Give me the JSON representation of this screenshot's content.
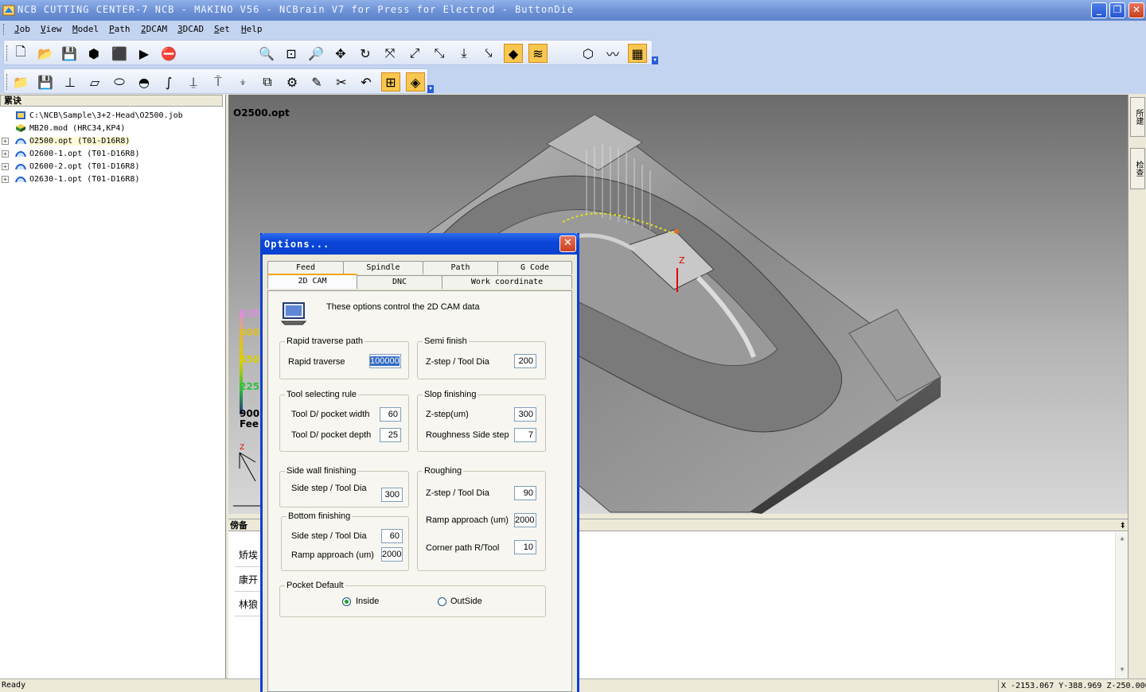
{
  "window": {
    "title": "NCB CUTTING CENTER-7 NCB - MAKINO V56 - NCBrain V7 for Press for Electrod - ButtonDie",
    "min_icon": "minimize-icon",
    "max_icon": "maximize-icon",
    "close_icon": "close-icon",
    "min_glyph": "_",
    "max_glyph": "❐",
    "close_glyph": "✕"
  },
  "menu": [
    "Job",
    "View",
    "Model",
    "Path",
    "2DCAM",
    "3DCAD",
    "Set",
    "Help"
  ],
  "toolbar_row1": [
    {
      "icon": "new-file-icon",
      "glyph": "🗋"
    },
    {
      "icon": "open-add-icon",
      "glyph": "📂"
    },
    {
      "icon": "save-icon",
      "glyph": "💾"
    },
    {
      "icon": "tools-library-icon",
      "glyph": "⬢"
    },
    {
      "icon": "box-model-icon",
      "glyph": "⬛"
    },
    {
      "icon": "run-icon",
      "glyph": "▶"
    },
    {
      "icon": "stop-icon",
      "glyph": "⛔"
    },
    {
      "icon": "zoom-fit-icon",
      "glyph": "🔍"
    },
    {
      "icon": "zoom-window-icon",
      "glyph": "⊡"
    },
    {
      "icon": "zoom-out-icon",
      "glyph": "🔎"
    },
    {
      "icon": "pan-icon",
      "glyph": "✥"
    },
    {
      "icon": "rotate-icon",
      "glyph": "↻"
    },
    {
      "icon": "view-iso-icon",
      "glyph": "⤧"
    },
    {
      "icon": "view-front-icon",
      "glyph": "⤢"
    },
    {
      "icon": "view-side-icon",
      "glyph": "⤡"
    },
    {
      "icon": "view-top-icon",
      "glyph": "⤓"
    },
    {
      "icon": "view-axis-icon",
      "glyph": "⤥"
    },
    {
      "icon": "shaded-view-icon",
      "glyph": "◆"
    },
    {
      "icon": "path-view-icon",
      "glyph": "≋"
    },
    {
      "icon": "stock-icon",
      "glyph": "⬡"
    },
    {
      "icon": "surface-icon",
      "glyph": "〰"
    },
    {
      "icon": "2d-grid-icon",
      "glyph": "▦"
    }
  ],
  "toolbar_row2": [
    {
      "icon": "open-folder-icon",
      "glyph": "📁"
    },
    {
      "icon": "save-disk-icon",
      "glyph": "💾"
    },
    {
      "icon": "origin-icon",
      "glyph": "⊥"
    },
    {
      "icon": "plane-icon",
      "glyph": "▱"
    },
    {
      "icon": "cylinder-icon",
      "glyph": "⬭"
    },
    {
      "icon": "half-shape-icon",
      "glyph": "◓"
    },
    {
      "icon": "curve-icon",
      "glyph": "∫"
    },
    {
      "icon": "ball-tool-icon",
      "glyph": "⍊"
    },
    {
      "icon": "flat-tool-icon",
      "glyph": "⍑"
    },
    {
      "icon": "drill-tool-icon",
      "glyph": "⍖"
    },
    {
      "icon": "layout-icon",
      "glyph": "⧉"
    },
    {
      "icon": "settings-group-icon",
      "glyph": "⚙"
    },
    {
      "icon": "eraser-icon",
      "glyph": "✎"
    },
    {
      "icon": "scissors-icon",
      "glyph": "✂"
    },
    {
      "icon": "undo-icon",
      "glyph": "↶"
    },
    {
      "icon": "grid-select-icon",
      "glyph": "⊞"
    },
    {
      "icon": "highlight-icon",
      "glyph": "◈"
    }
  ],
  "left_panel": {
    "header": "累诀",
    "tree": [
      {
        "label": "C:\\NCB\\Sample\\3+2-Head\\O2500.job",
        "icon": "job-file-icon",
        "expand": false
      },
      {
        "label": "MB20.mod (HRC34,KP4)",
        "icon": "model-cube-icon",
        "expand": false
      },
      {
        "label": "O2500.opt (T01-D16R8)",
        "icon": "toolpath-icon",
        "expand": true,
        "selected": true
      },
      {
        "label": "O2600-1.opt (T01-D16R8)",
        "icon": "toolpath-icon",
        "expand": true
      },
      {
        "label": "O2600-2.opt (T01-D16R8)",
        "icon": "toolpath-icon",
        "expand": true
      },
      {
        "label": "O2630-1.opt (T01-D16R8)",
        "icon": "toolpath-icon",
        "expand": true
      }
    ],
    "expand_glyph": "+"
  },
  "viewport": {
    "title": "O2500.opt",
    "legend": [
      {
        "text": "120",
        "color": "#e08ae8"
      },
      {
        "text": "600",
        "color": "#e0c020"
      },
      {
        "text": "450",
        "color": "#d8d000"
      },
      {
        "text": "225",
        "color": "#30c040"
      },
      {
        "text": "900",
        "color": "#000000"
      },
      {
        "text": "Fee",
        "color": "#000000"
      }
    ],
    "axis_z": "Z",
    "axis_z_part": "Z"
  },
  "right_tabs": [
    "所建",
    "检查"
  ],
  "bottom_panel": {
    "header": "傍备",
    "rows": [
      "矫埃",
      "康开",
      "林狼"
    ],
    "pin_glyph": "‡",
    "up_glyph": "▲",
    "down_glyph": "▼"
  },
  "status": {
    "text": "Ready",
    "coords": "X -2153.067 Y-388.969 Z-250.000"
  },
  "dialog": {
    "title": "Options...",
    "close_glyph": "✕",
    "tabs_back": [
      "Feed",
      "Spindle",
      "Path",
      "G Code"
    ],
    "tabs_front": [
      "2D CAM",
      "DNC",
      "Work coordinate"
    ],
    "description": "These options control the 2D CAM data",
    "groups": {
      "rapid": {
        "title": "Rapid traverse path",
        "label": "Rapid traverse",
        "value": "100000"
      },
      "semi": {
        "title": "Semi finish",
        "label": "Z-step / Tool Dia",
        "value": "200"
      },
      "tool_rule": {
        "title": "Tool selecting rule",
        "width_label": "Tool D/ pocket width",
        "width_value": "60",
        "depth_label": "Tool D/ pocket depth",
        "depth_value": "25"
      },
      "slop": {
        "title": "Slop finishing",
        "zstep_label": "Z-step(um)",
        "zstep_value": "300",
        "rough_label": "Roughness Side step",
        "rough_value": "7"
      },
      "side_wall": {
        "title": "Side wall finishing",
        "label": "Side step / Tool Dia",
        "value": "300"
      },
      "roughing": {
        "title": "Roughing",
        "zstep_label": "Z-step / Tool Dia",
        "zstep_value": "90",
        "ramp_label": "Ramp approach (um)",
        "ramp_value": "2000",
        "corner_label": "Corner path R/Tool",
        "corner_value": "10"
      },
      "bottom": {
        "title": "Bottom finishing",
        "side_label": "Side step / Tool Dia",
        "side_value": "60",
        "ramp_label": "Ramp approach (um)",
        "ramp_value": "2000"
      },
      "pocket": {
        "title": "Pocket Default",
        "inside": "Inside",
        "outside": "OutSide",
        "selected": "Inside"
      }
    }
  }
}
